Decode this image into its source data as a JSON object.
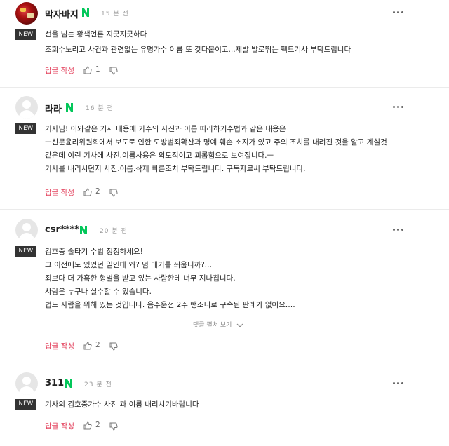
{
  "new_tag": "NEW",
  "reply_label": "답글 작성",
  "expand_label": "댓글 펼쳐 보기",
  "accent_color": "#e33f5b",
  "n_badge_color": "#03c75a",
  "comments": [
    {
      "nickname": "막자바지",
      "time": "15 분 전",
      "lines": [
        "선을 넘는 황색언론 지긋지긋하다",
        "조회수노리고 사건과 관련없는 유명가수 이름 또 갖다붙이고...제발 발로뛰는 팩트기사 부탁드립니다"
      ],
      "likes": "1"
    },
    {
      "nickname": "라라",
      "time": "16 분 전",
      "lines": [
        "기자님! 이와같은 기사 내용에 가수의 사진과 이름 따라하기수법과 같은 내용은",
        "ㅡ신문윤리위원회에서 보도로 인한 모방범죄확산과 명예 훼손 소지가 있고 주의 조치를 내려진 것을 알고 계실것",
        "같은데 이런 기사에 사진.이름사용은 의도적이고 괴롭힘으로 보여집니다.ㅡ",
        "기사를 내리시던지 사진.이름.삭제 빠른조치 부탁드립니다. 구독자로써 부탁드립니다."
      ],
      "likes": "2"
    },
    {
      "nickname": "csr****",
      "time": "20 분 전",
      "lines": [
        "김호중 술타기 수법 정정하세요!",
        "그 이전에도 있었던 일인데 왜? 덤 테기를 씌웁니까?...",
        "죄보다 더 가혹한 형벌을 받고 있는 사람한테 너무 지나칩니다.",
        "사람은 누구나 실수할 수 있습니다.",
        "법도 사람을 위해 있는 것입니다. 음주운전 2주 뺑소니로 구속된 판례가 없어요.…"
      ],
      "likes": "2"
    },
    {
      "nickname": "311",
      "time": "23 분 전",
      "lines": [
        "기사의 김호중가수 사진 과 이름 내리시기바랍니다"
      ],
      "likes": "2"
    }
  ]
}
